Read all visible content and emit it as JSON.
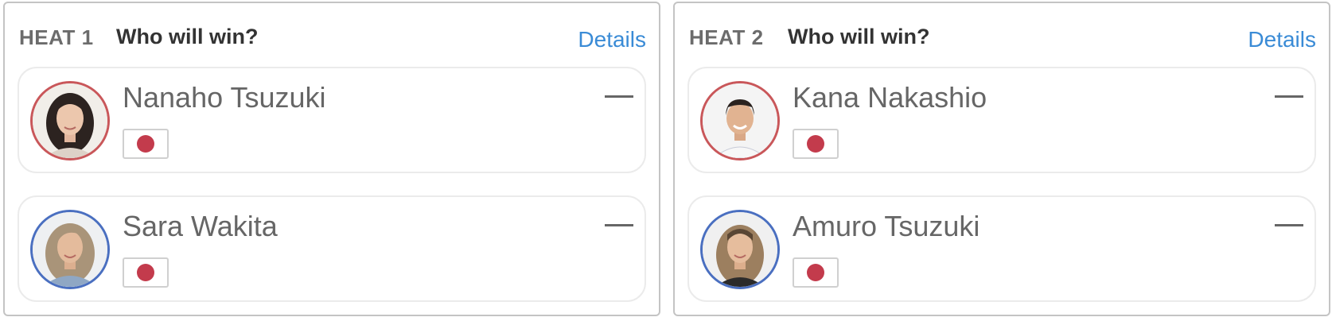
{
  "colors": {
    "accent_link": "#3a8bd6",
    "red_corner": "#c9575a",
    "blue_corner": "#4a6fc0",
    "flag_disc": "#c33b4c"
  },
  "heats": [
    {
      "label": "HEAT 1",
      "question": "Who will win?",
      "details_label": "Details",
      "surfers": [
        {
          "name": "Nanaho Tsuzuki",
          "corner": "red",
          "country_icon": "japan-flag-icon",
          "pick": "—"
        },
        {
          "name": "Sara Wakita",
          "corner": "blue",
          "country_icon": "japan-flag-icon",
          "pick": "—"
        }
      ]
    },
    {
      "label": "HEAT 2",
      "question": "Who will win?",
      "details_label": "Details",
      "surfers": [
        {
          "name": "Kana Nakashio",
          "corner": "red",
          "country_icon": "japan-flag-icon",
          "pick": "—"
        },
        {
          "name": "Amuro Tsuzuki",
          "corner": "blue",
          "country_icon": "japan-flag-icon",
          "pick": "—"
        }
      ]
    }
  ]
}
